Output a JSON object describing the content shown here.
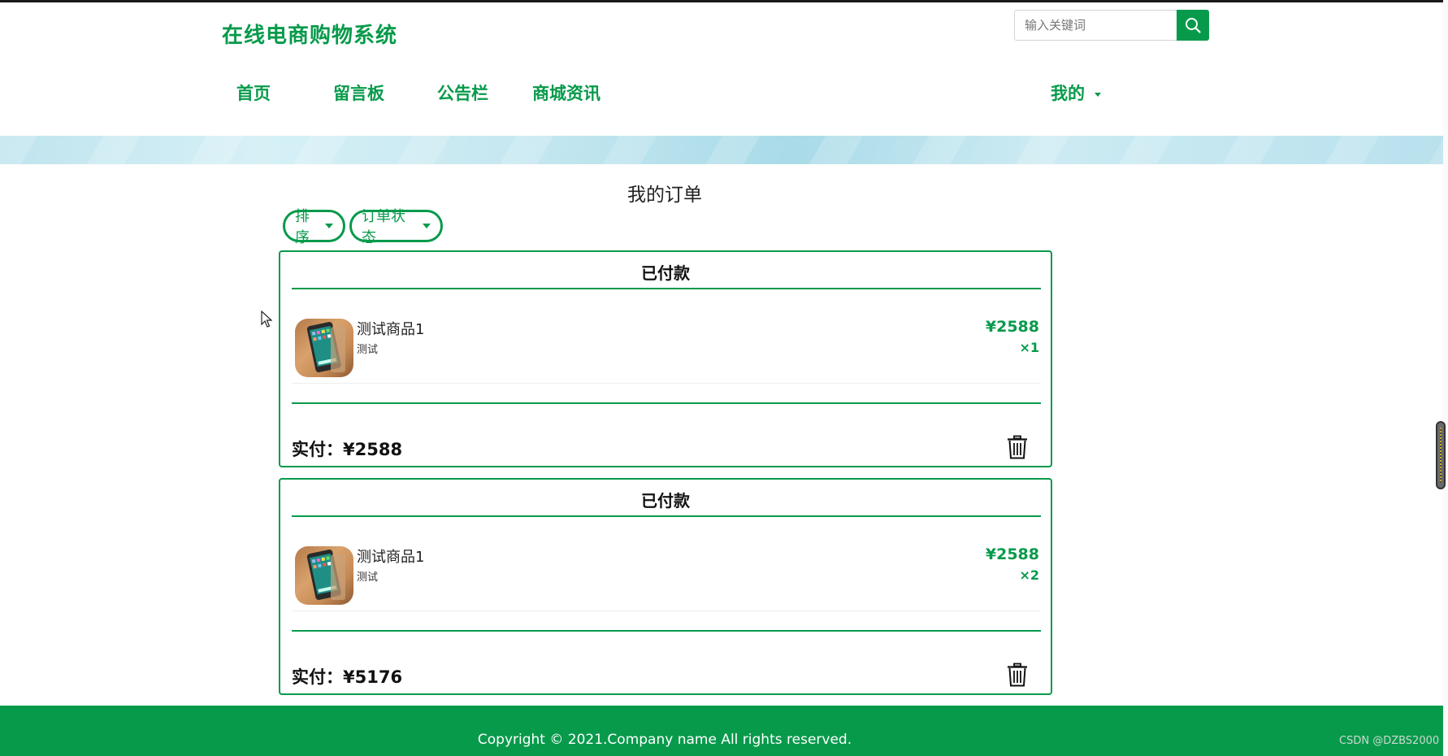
{
  "header": {
    "brand": "在线电商购物系统",
    "search_placeholder": "输入关键词",
    "nav": [
      "首页",
      "留言板",
      "公告栏",
      "商城资讯"
    ],
    "user_menu": "我的"
  },
  "page": {
    "title": "我的订单",
    "filters": [
      "排序",
      "订单状态"
    ]
  },
  "orders": [
    {
      "status": "已付款",
      "item_name": "测试商品1",
      "item_desc": "测试",
      "price": "¥2588",
      "qty": "×1",
      "paid_label": "实付：",
      "paid_amount": "¥2588"
    },
    {
      "status": "已付款",
      "item_name": "测试商品1",
      "item_desc": "测试",
      "price": "¥2588",
      "qty": "×2",
      "paid_label": "实付：",
      "paid_amount": "¥5176"
    }
  ],
  "footer": {
    "copyright": "Copyright © 2021.Company name All rights reserved."
  },
  "watermark": "CSDN @DZBS2000",
  "colors": {
    "brand_green": "#079a4b",
    "banner_blue": "#c3e6f0"
  },
  "icons": {
    "search": "search-icon",
    "trash": "trash-icon",
    "caret": "caret-down-icon",
    "product": "tablet-product-image"
  }
}
